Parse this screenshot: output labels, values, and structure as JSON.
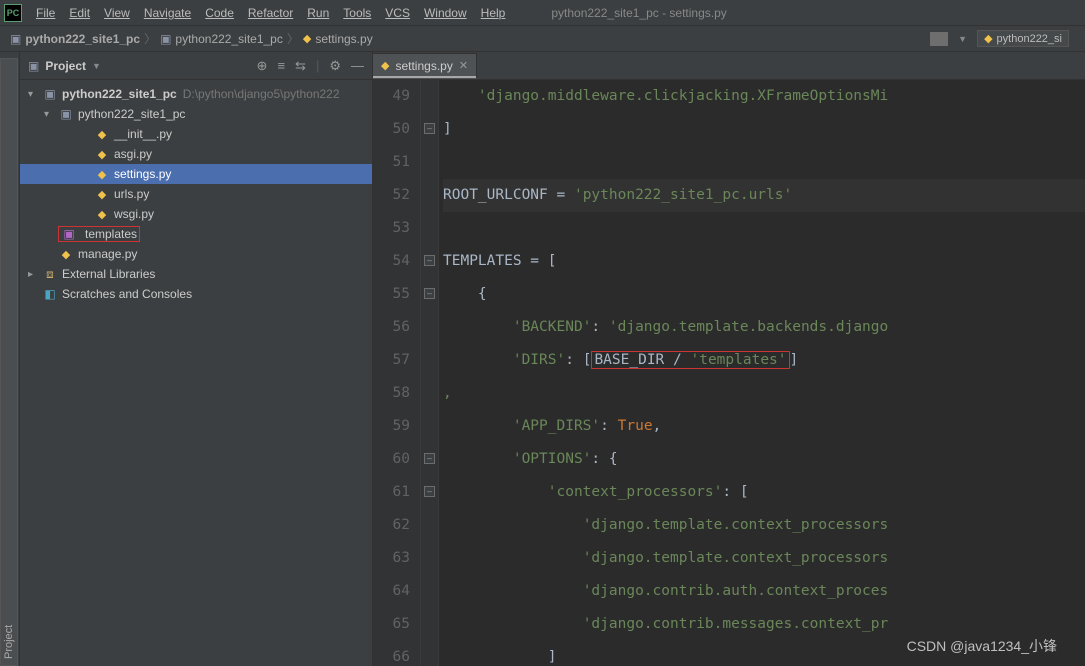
{
  "titlebar": {
    "app_abbrev": "PC",
    "window_title": "python222_site1_pc - settings.py",
    "menu": [
      "File",
      "Edit",
      "View",
      "Navigate",
      "Code",
      "Refactor",
      "Run",
      "Tools",
      "VCS",
      "Window",
      "Help"
    ]
  },
  "breadcrumb": {
    "items": [
      "python222_site1_pc",
      "python222_site1_pc",
      "settings.py"
    ],
    "right_tab": "python222_si"
  },
  "project_panel": {
    "title": "Project",
    "root_name": "python222_site1_pc",
    "root_path": "D:\\python\\django5\\python222",
    "package_name": "python222_site1_pc",
    "files": {
      "init": "__init__.py",
      "asgi": "asgi.py",
      "settings": "settings.py",
      "urls": "urls.py",
      "wsgi": "wsgi.py"
    },
    "templates_dir": "templates",
    "manage": "manage.py",
    "ext_libs": "External Libraries",
    "scratches": "Scratches and Consoles"
  },
  "side_tab": {
    "project": "Project"
  },
  "editor": {
    "tab_label": "settings.py",
    "gutter_start": 49,
    "code": {
      "l49": "'django.middleware.clickjacking.XFrameOptionsMi",
      "l50": "]",
      "l52_lhs": "ROOT_URLCONF",
      "l52_eq": " = ",
      "l52_rhs": "'python222_site1_pc.urls'",
      "l54_lhs": "TEMPLATES",
      "l54_eq": " = [",
      "l55": "{",
      "l56_key": "'BACKEND'",
      "l56_val": "'django.template.backends.django",
      "l57_key": "'DIRS'",
      "l57_open": "[",
      "l57_base": "BASE_DIR",
      "l57_slash": " / ",
      "l57_tpl": "'templates'",
      "l57_close": "]",
      "l58": ",",
      "l59_key": "'APP_DIRS'",
      "l59_val": "True",
      "l60_key": "'OPTIONS'",
      "l60_val": "{",
      "l61_key": "'context_processors'",
      "l61_val": "[",
      "l62": "'django.template.context_processors",
      "l63": "'django.template.context_processors",
      "l64": "'django.contrib.auth.context_proces",
      "l65": "'django.contrib.messages.context_pr"
    }
  },
  "watermark": "CSDN @java1234_小锋"
}
